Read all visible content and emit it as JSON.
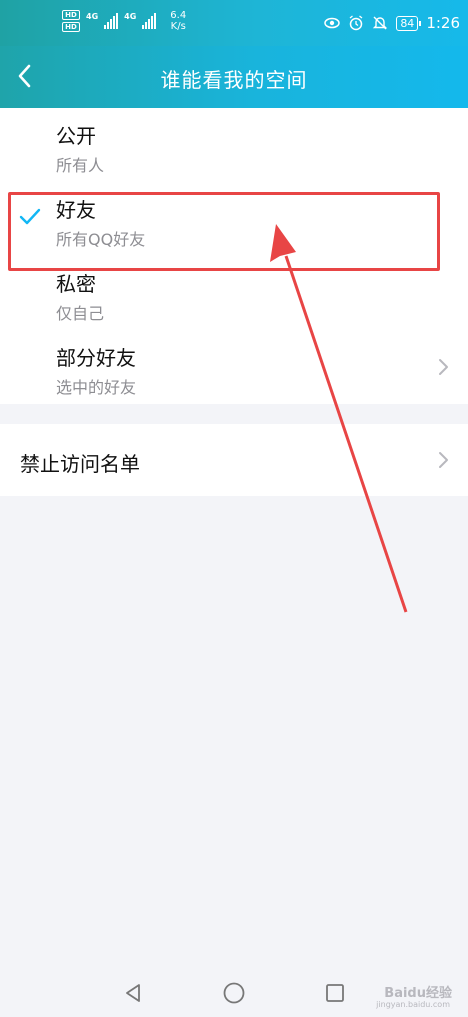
{
  "status_bar": {
    "hd1": "HD",
    "hd2": "HD",
    "net1": "4G",
    "net2": "4G",
    "speed_value": "6.4",
    "speed_unit": "K/s",
    "battery": "84",
    "time": "1:26"
  },
  "header": {
    "title": "谁能看我的空间"
  },
  "options": [
    {
      "title": "公开",
      "subtitle": "所有人",
      "selected": false
    },
    {
      "title": "好友",
      "subtitle": "所有QQ好友",
      "selected": true
    },
    {
      "title": "私密",
      "subtitle": "仅自己",
      "selected": false
    },
    {
      "title": "部分好友",
      "subtitle": "选中的好友",
      "selected": false,
      "has_chevron": true
    }
  ],
  "blacklist": {
    "label": "禁止访问名单"
  },
  "colors": {
    "accent": "#1eb5d6",
    "check": "#12b7f5",
    "annotation": "#e84545"
  },
  "watermark": {
    "brand": "Baidu经验",
    "url": "jingyan.baidu.com"
  }
}
